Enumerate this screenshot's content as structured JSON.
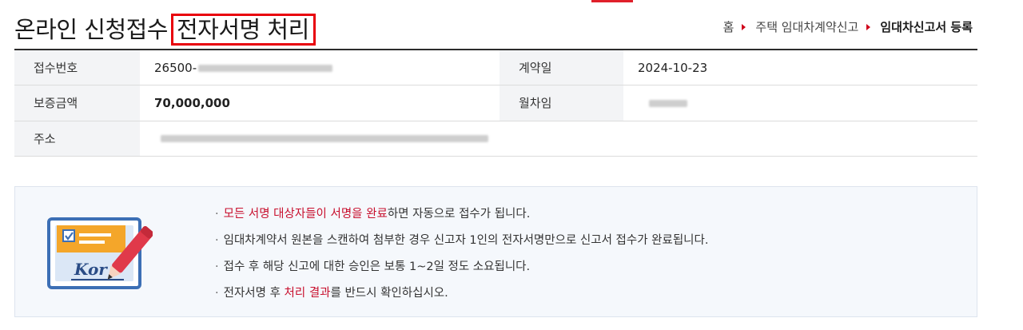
{
  "header": {
    "title_prefix": "온라인 신청접수",
    "title_highlight": "전자서명 처리"
  },
  "breadcrumb": {
    "home": "홈",
    "level1": "주택 임대차계약신고",
    "current": "임대차신고서 등록"
  },
  "info": {
    "receipt_no_label": "접수번호",
    "receipt_no_value": "26500-",
    "contract_date_label": "계약일",
    "contract_date_value": "2024-10-23",
    "deposit_label": "보증금액",
    "deposit_value": "70,000,000",
    "monthly_rent_label": "월차임",
    "address_label": "주소"
  },
  "notice": {
    "bullet": "·",
    "line1_red": "모든 서명 대상자들이 서명을 완료",
    "line1_rest": "하면 자동으로 접수가 됩니다.",
    "line2": "임대차계약서 원본을 스캔하여 첨부한 경우 신고자 1인의 전자서명만으로 신고서 접수가 완료됩니다.",
    "line3": "접수 후 해당 신고에 대한 승인은 보통 1~2일 정도 소요됩니다.",
    "line4_a": "전자서명 후 ",
    "line4_red": "처리 결과",
    "line4_b": "를 반드시 확인하십시오.",
    "icon_text": "Kor"
  },
  "colors": {
    "accent_red": "#e8000b",
    "notice_red": "#c8102e",
    "icon_blue": "#3c6fb5",
    "icon_orange": "#f4a62a",
    "pen_red": "#e0394a"
  },
  "icons": {
    "breadcrumb_separator": "triangle-right-icon",
    "notice": "signed-document-pen-icon"
  }
}
